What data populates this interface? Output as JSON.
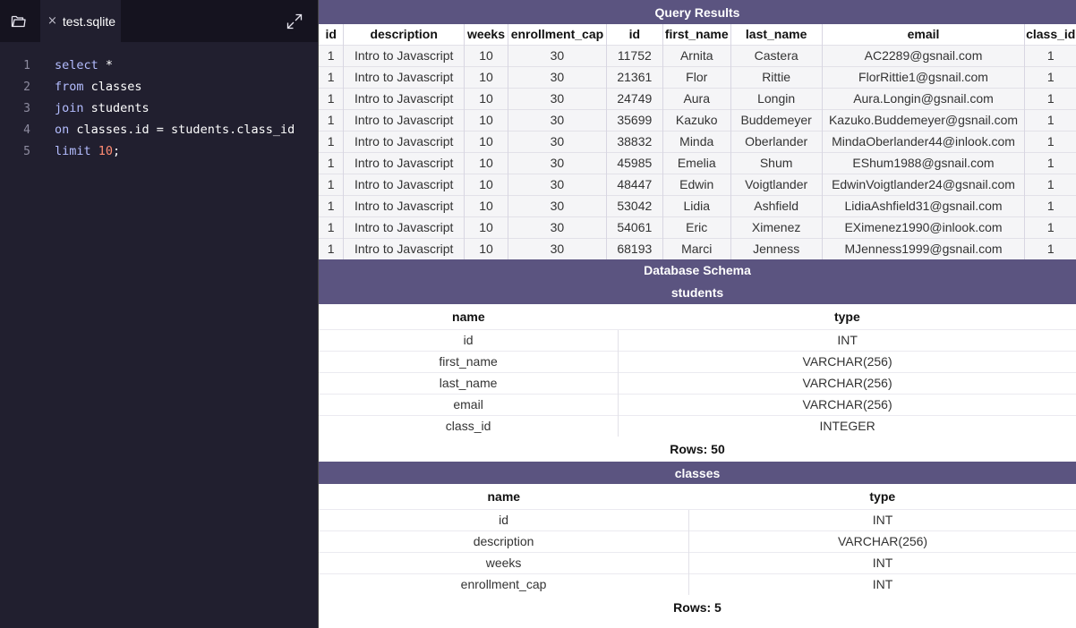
{
  "editor": {
    "file_tab": {
      "close_glyph": "×",
      "name": "test.sqlite"
    },
    "icons": {
      "folder": "folder-icon",
      "expand": "expand-icon"
    },
    "colors": {
      "keyword": "#b4bdff",
      "number": "#ff8b73",
      "background": "#211f2f"
    },
    "lines": [
      {
        "number": "1",
        "tokens": [
          {
            "t": "select",
            "c": "kw"
          },
          {
            "t": " *",
            "c": ""
          }
        ]
      },
      {
        "number": "2",
        "tokens": [
          {
            "t": "from",
            "c": "kw"
          },
          {
            "t": " classes",
            "c": ""
          }
        ]
      },
      {
        "number": "3",
        "tokens": [
          {
            "t": "join",
            "c": "kw"
          },
          {
            "t": " students",
            "c": ""
          }
        ]
      },
      {
        "number": "4",
        "tokens": [
          {
            "t": "on",
            "c": "kw"
          },
          {
            "t": " classes.id = students.class_id",
            "c": ""
          }
        ]
      },
      {
        "number": "5",
        "tokens": [
          {
            "t": "limit",
            "c": "kw"
          },
          {
            "t": " ",
            "c": ""
          },
          {
            "t": "10",
            "c": "num"
          },
          {
            "t": ";",
            "c": ""
          }
        ]
      }
    ]
  },
  "query_results": {
    "title": "Query Results",
    "columns": [
      "id",
      "description",
      "weeks",
      "enrollment_cap",
      "id",
      "first_name",
      "last_name",
      "email",
      "class_id"
    ],
    "rows": [
      [
        "1",
        "Intro to Javascript",
        "10",
        "30",
        "11752",
        "Arnita",
        "Castera",
        "AC2289@gsnail.com",
        "1"
      ],
      [
        "1",
        "Intro to Javascript",
        "10",
        "30",
        "21361",
        "Flor",
        "Rittie",
        "FlorRittie1@gsnail.com",
        "1"
      ],
      [
        "1",
        "Intro to Javascript",
        "10",
        "30",
        "24749",
        "Aura",
        "Longin",
        "Aura.Longin@gsnail.com",
        "1"
      ],
      [
        "1",
        "Intro to Javascript",
        "10",
        "30",
        "35699",
        "Kazuko",
        "Buddemeyer",
        "Kazuko.Buddemeyer@gsnail.com",
        "1"
      ],
      [
        "1",
        "Intro to Javascript",
        "10",
        "30",
        "38832",
        "Minda",
        "Oberlander",
        "MindaOberlander44@inlook.com",
        "1"
      ],
      [
        "1",
        "Intro to Javascript",
        "10",
        "30",
        "45985",
        "Emelia",
        "Shum",
        "EShum1988@gsnail.com",
        "1"
      ],
      [
        "1",
        "Intro to Javascript",
        "10",
        "30",
        "48447",
        "Edwin",
        "Voigtlander",
        "EdwinVoigtlander24@gsnail.com",
        "1"
      ],
      [
        "1",
        "Intro to Javascript",
        "10",
        "30",
        "53042",
        "Lidia",
        "Ashfield",
        "LidiaAshfield31@gsnail.com",
        "1"
      ],
      [
        "1",
        "Intro to Javascript",
        "10",
        "30",
        "54061",
        "Eric",
        "Ximenez",
        "EXimenez1990@inlook.com",
        "1"
      ],
      [
        "1",
        "Intro to Javascript",
        "10",
        "30",
        "68193",
        "Marci",
        "Jenness",
        "MJenness1999@gsnail.com",
        "1"
      ]
    ]
  },
  "schema": {
    "title": "Database Schema",
    "tables": [
      {
        "name": "students",
        "headers": {
          "name": "name",
          "type": "type"
        },
        "fields": [
          {
            "name": "id",
            "type": "INT"
          },
          {
            "name": "first_name",
            "type": "VARCHAR(256)"
          },
          {
            "name": "last_name",
            "type": "VARCHAR(256)"
          },
          {
            "name": "email",
            "type": "VARCHAR(256)"
          },
          {
            "name": "class_id",
            "type": "INTEGER"
          }
        ],
        "rows_label": "Rows: 50"
      },
      {
        "name": "classes",
        "headers": {
          "name": "name",
          "type": "type"
        },
        "fields": [
          {
            "name": "id",
            "type": "INT"
          },
          {
            "name": "description",
            "type": "VARCHAR(256)"
          },
          {
            "name": "weeks",
            "type": "INT"
          },
          {
            "name": "enrollment_cap",
            "type": "INT"
          }
        ],
        "rows_label": "Rows: 5"
      }
    ]
  },
  "theme": {
    "header_bg": "#5b5480",
    "row_bg": "#f5f5f7"
  }
}
